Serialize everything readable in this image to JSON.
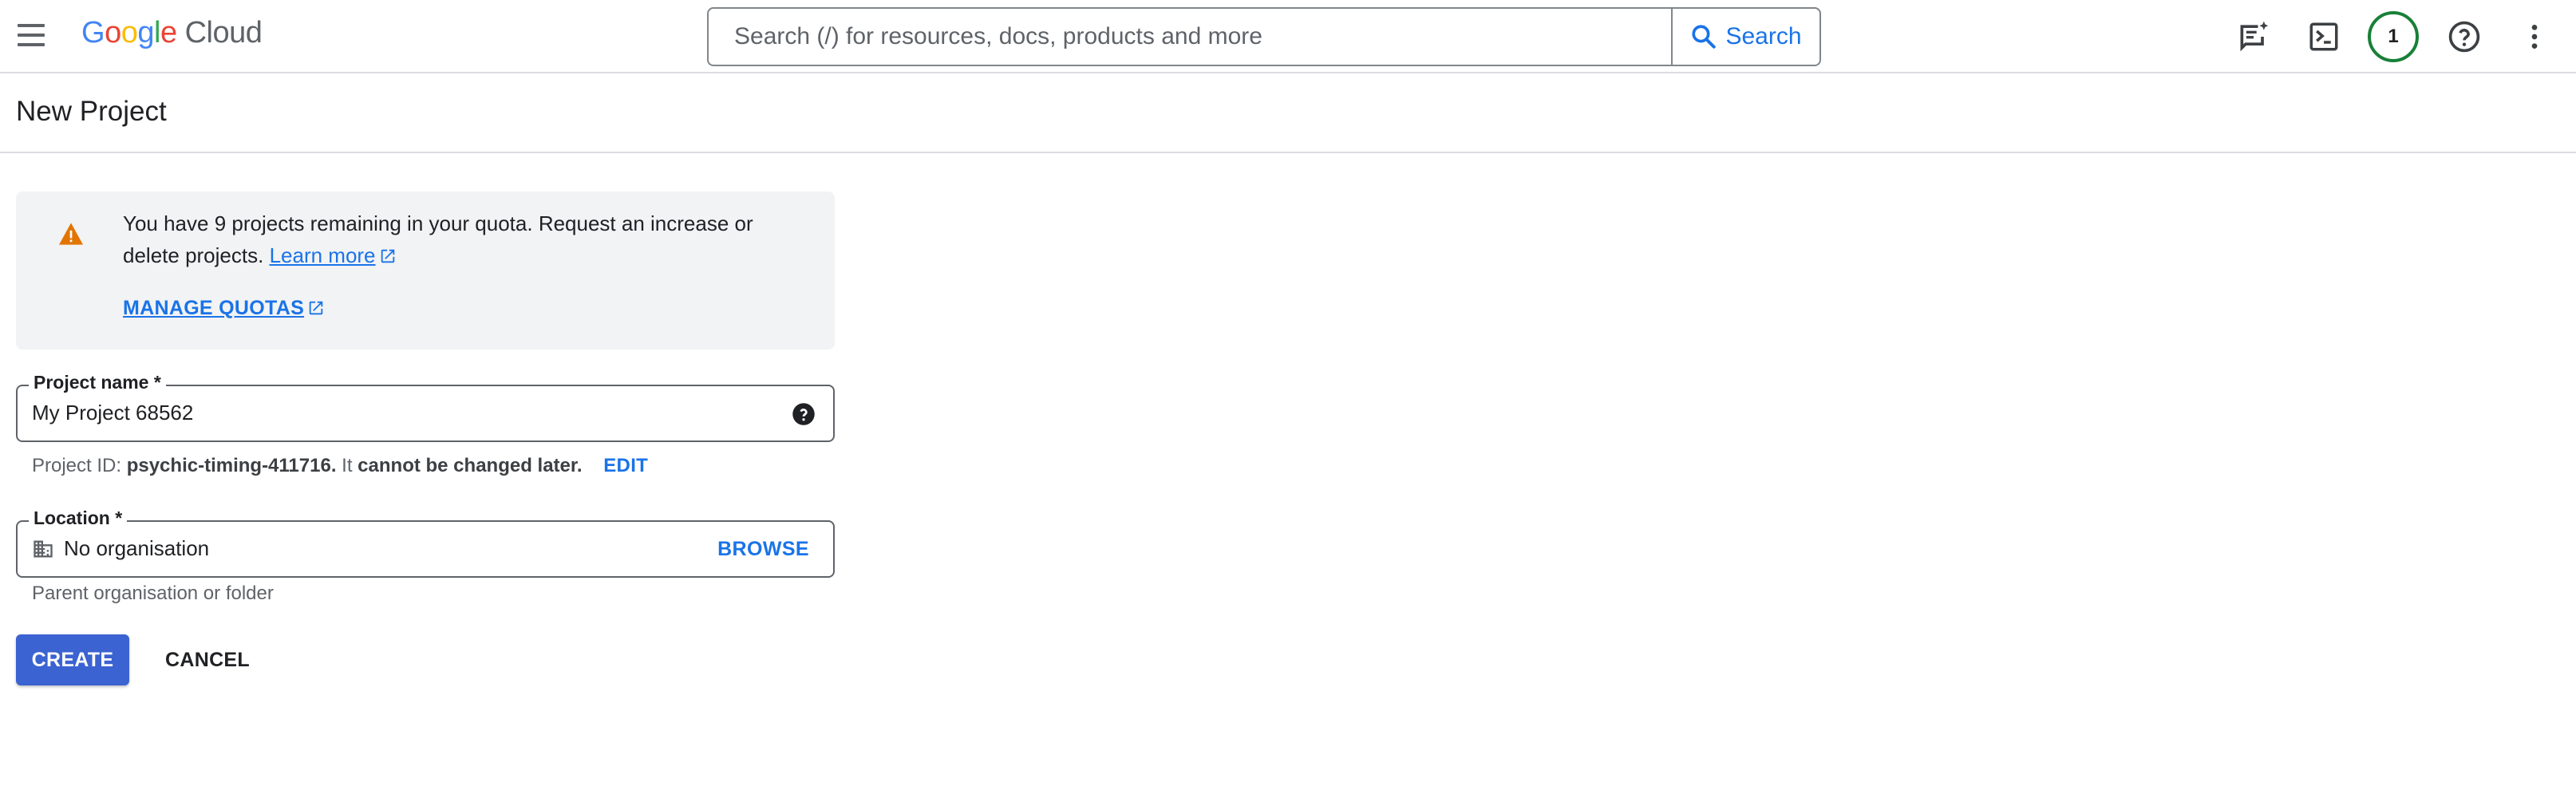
{
  "topbar": {
    "logo_google": [
      "G",
      "o",
      "o",
      "g",
      "l",
      "e"
    ],
    "logo_colors": [
      "#4285F4",
      "#EA4335",
      "#FBBC05",
      "#4285F4",
      "#34A853",
      "#EA4335"
    ],
    "logo_cloud": "Cloud",
    "search_placeholder": "Search (/) for resources, docs, products and more",
    "search_button": "Search",
    "avatar_initial": "1",
    "icons": [
      "menu-icon",
      "search-icon",
      "feedback-icon",
      "cloud-shell-icon",
      "help-icon",
      "more-vert-icon"
    ]
  },
  "page": {
    "title": "New Project"
  },
  "quota": {
    "message": "You have 9 projects remaining in your quota. Request an increase or delete projects.",
    "learn_more": "Learn more",
    "manage_quotas": "MANAGE QUOTAS",
    "warning_color": "#e37400"
  },
  "project_name": {
    "label": "Project name *",
    "value": "My Project 68562"
  },
  "project_id": {
    "prefix": "Project ID:",
    "id": "psychic-timing-411716.",
    "middle": "It",
    "bold_suffix": "cannot be changed later.",
    "edit": "EDIT"
  },
  "location": {
    "label": "Location *",
    "value": "No organisation",
    "browse": "BROWSE",
    "hint": "Parent organisation or folder"
  },
  "actions": {
    "create": "CREATE",
    "cancel": "CANCEL"
  },
  "colors": {
    "accent": "#1a73e8",
    "primary_button": "#3b63d1",
    "avatar_ring": "#188038"
  }
}
